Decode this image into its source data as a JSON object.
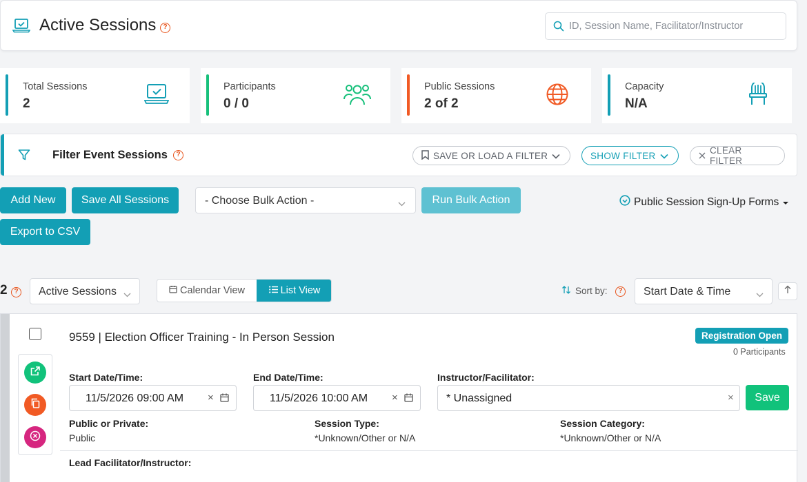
{
  "header": {
    "title": "Active Sessions",
    "help": "?",
    "search_placeholder": "ID, Session Name, Facilitator/Instructor"
  },
  "stats": [
    {
      "label": "Total Sessions",
      "value": "2",
      "color": "#139fb5",
      "icon": "laptop-icon"
    },
    {
      "label": "Participants",
      "value": "0 / 0",
      "color": "#17c07b",
      "icon": "users-icon"
    },
    {
      "label": "Public Sessions",
      "value": "2 of 2",
      "color": "#f15a24",
      "icon": "globe-icon"
    },
    {
      "label": "Capacity",
      "value": "N/A",
      "color": "#139fb5",
      "icon": "chair-icon"
    }
  ],
  "filter": {
    "title": "Filter Event Sessions",
    "save_load": "SAVE OR LOAD A FILTER",
    "show": "SHOW FILTER",
    "clear": "CLEAR FILTER"
  },
  "toolbar": {
    "add_new": "Add New",
    "save_all": "Save All Sessions",
    "bulk_action": "- Choose Bulk Action -",
    "run_bulk": "Run Bulk Action",
    "signup_forms": "Public Session Sign-Up Forms",
    "export_csv": "Export to CSV"
  },
  "list": {
    "count": "2",
    "status": "Active Sessions",
    "calendar_view": "Calendar View",
    "list_view": "List View",
    "sort_by": "Sort by:",
    "sort_value": "Start Date & Time"
  },
  "session": {
    "title": "9559 | Election Officer Training - In Person Session",
    "status_badge": "Registration Open",
    "participants": "0 Participants",
    "start_label": "Start Date/Time:",
    "start_value": "11/5/2026 09:00 AM",
    "end_label": "End Date/Time:",
    "end_value": "11/5/2026 10:00 AM",
    "instructor_label": "Instructor/Facilitator:",
    "instructor_value": "* Unassigned",
    "save": "Save",
    "public_label": "Public or Private:",
    "public_value": "Public",
    "type_label": "Session Type:",
    "type_value": "*Unknown/Other or N/A",
    "category_label": "Session Category:",
    "category_value": "*Unknown/Other or N/A",
    "lead_label": "Lead Facilitator/Instructor:"
  },
  "colors": {
    "accent": "#139fb5",
    "success": "#11c27b",
    "danger": "#e8541c",
    "magenta": "#d6267f"
  }
}
